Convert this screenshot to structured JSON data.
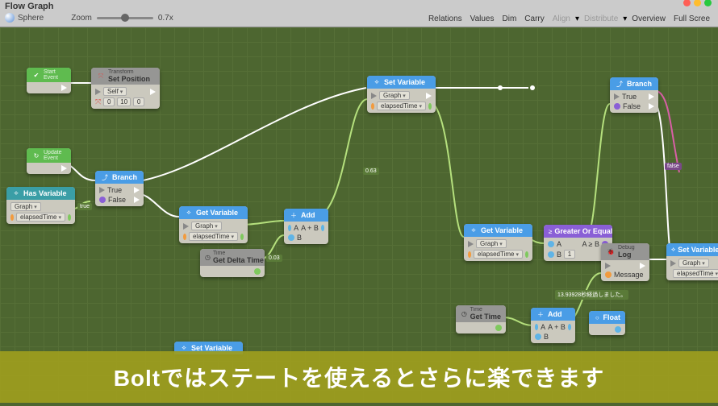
{
  "toolbar": {
    "title": "Flow Graph",
    "object": "Sphere",
    "zoom_label": "Zoom",
    "zoom_value": "0.7x",
    "buttons": {
      "relations": "Relations",
      "values": "Values",
      "dim": "Dim",
      "carry": "Carry",
      "align": "Align",
      "distribute": "Distribute",
      "overview": "Overview",
      "fullscreen": "Full Scree"
    }
  },
  "nodes": {
    "start": {
      "cat": "Event",
      "title": "Start"
    },
    "transform": {
      "cat": "Transform",
      "title": "Set Position",
      "self": "Self",
      "nums": [
        "0",
        "10",
        "0"
      ]
    },
    "update": {
      "cat": "Event",
      "title": "Update"
    },
    "hasvar": {
      "title": "Has Variable",
      "scope": "Graph",
      "var": "elapsedTime"
    },
    "branch1": {
      "title": "Branch",
      "t": "True",
      "f": "False"
    },
    "getvar1": {
      "title": "Get Variable",
      "scope": "Graph",
      "var": "elapsedTime"
    },
    "delta": {
      "cat": "Time",
      "title": "Get Delta Time"
    },
    "add1": {
      "title": "Add",
      "ab": "A + B",
      "a": "A",
      "b": "B"
    },
    "setvar1": {
      "title": "Set Variable",
      "scope": "Graph",
      "var": "elapsedTime"
    },
    "getvar2": {
      "title": "Get Variable",
      "scope": "Graph",
      "var": "elapsedTime"
    },
    "greater": {
      "title": "Greater Or Equal",
      "a": "A",
      "ab": "A ≥ B",
      "b": "B",
      "bval": "1"
    },
    "branch2": {
      "title": "Branch",
      "t": "True",
      "f": "False"
    },
    "gettime": {
      "cat": "Time",
      "title": "Get Time"
    },
    "add2": {
      "title": "Add",
      "ab": "A + B",
      "a": "A",
      "b": "B"
    },
    "float": {
      "title": "Float"
    },
    "debug": {
      "cat": "Debug",
      "title": "Log",
      "msg": "Message"
    },
    "setvar2": {
      "title": "Set Variable",
      "scope": "Graph",
      "var": "elapsedTime"
    },
    "setvar3": {
      "title": "Set Variable"
    },
    "dbg_tiny1": "0.63",
    "dbg_tiny2": "0.03",
    "dbg_tiny3": "true",
    "dbg_tiny4": "false",
    "dbg_msg": "13.93928秒経過しました。"
  },
  "banner": {
    "text": "Boltではステートを使えるとさらに楽できます"
  }
}
